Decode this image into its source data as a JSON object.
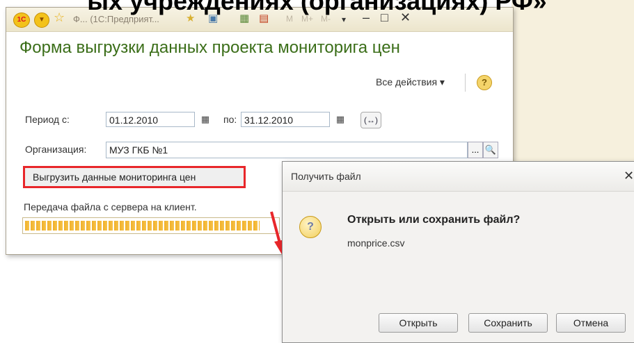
{
  "slide": {
    "title_fragment": "ых учреждениях (организациях) РФ»"
  },
  "main_window": {
    "titlebar": {
      "logo": "1С",
      "title": "Ф... (1С:Предприят...",
      "memory_buttons": [
        "M",
        "M+",
        "M-"
      ]
    },
    "heading": "Форма выгрузки данных проекта мониторига цен",
    "all_actions": "Все действия ▾",
    "help": "?",
    "period_label": "Период с:",
    "date_from": "01.12.2010",
    "to_label": "по:",
    "date_to": "31.12.2010",
    "period_button": "(↔)",
    "org_label": "Организация:",
    "org_value": "МУЗ ГКБ №1",
    "select_button": "...",
    "export_button": "Выгрузить данные мониторинга цен",
    "progress_text": "Передача файла с сервера на клиент.",
    "progress_fraction": 0.93
  },
  "dialog": {
    "title": "Получить файл",
    "close": "✕",
    "question": "Открыть или сохранить файл?",
    "filename": "monprice.csv",
    "buttons": {
      "open": "Открыть",
      "save": "Сохранить",
      "cancel": "Отмена"
    }
  },
  "colors": {
    "heading": "#3b6e19",
    "highlight": "#e8262a",
    "progress": "#f0b02a",
    "right_background": "#f6f0dd"
  },
  "icons": [
    "1c-logo",
    "menu-icon",
    "star-icon",
    "favorite-icon",
    "calendar-icon",
    "search-icon",
    "question-icon"
  ]
}
